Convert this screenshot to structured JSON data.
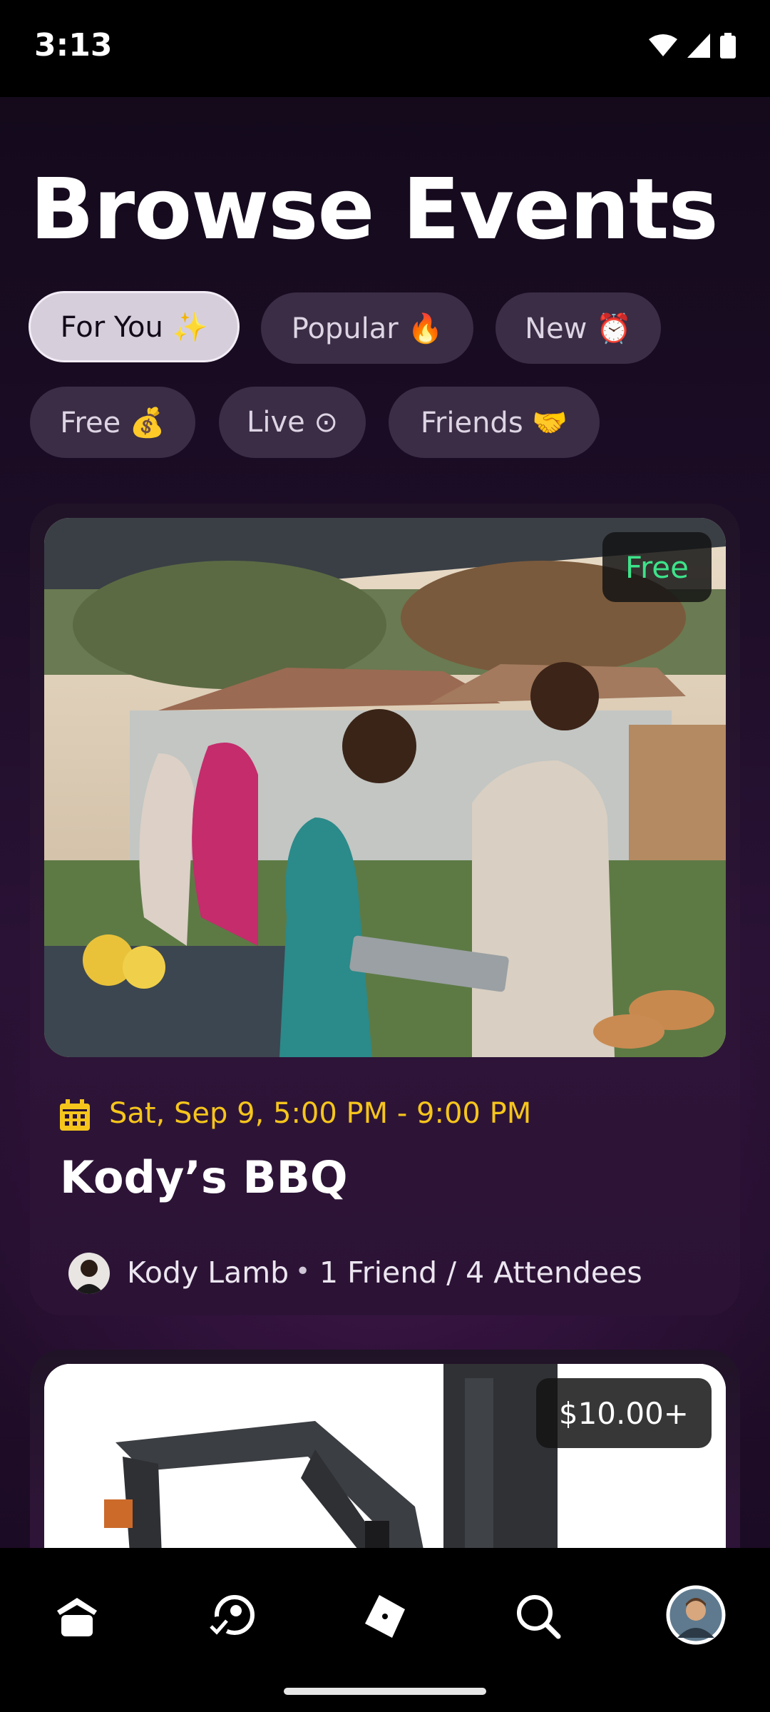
{
  "status_bar": {
    "time": "3:13"
  },
  "page": {
    "title": "Browse Events"
  },
  "filters": [
    {
      "label": "For You ✨",
      "active": true
    },
    {
      "label": "Popular 🔥",
      "active": false
    },
    {
      "label": "New ⏰",
      "active": false
    },
    {
      "label": "Free 💰",
      "active": false
    },
    {
      "label": "Live ⊙",
      "active": false
    },
    {
      "label": "Friends 🤝",
      "active": false
    }
  ],
  "events": [
    {
      "price": "Free",
      "date": "Sat, Sep 9, 5:00 PM - 9:00 PM",
      "title": "Kody’s BBQ",
      "host": "Kody Lamb",
      "separator": "•",
      "attendance": "1 Friend / 4 Attendees",
      "image_icon": "backyard-bbq-photo"
    },
    {
      "price": "$10.00+",
      "image_icon": "forklift-photo"
    }
  ],
  "bottom_nav": {
    "items": [
      "home-icon",
      "friends-icon",
      "tickets-icon",
      "search-icon",
      "profile-avatar"
    ]
  },
  "colors": {
    "accent_date": "#f6c51c",
    "free_green": "#3de38a",
    "chip_bg": "#3a2d45",
    "chip_active_bg": "#d6cfdb"
  }
}
